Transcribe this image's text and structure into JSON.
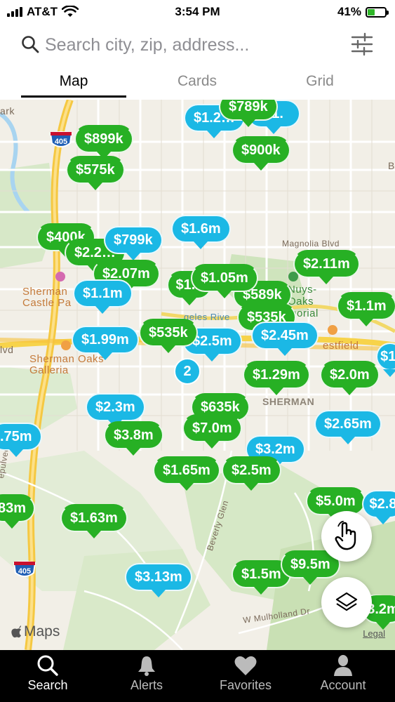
{
  "status_bar": {
    "carrier": "AT&T",
    "time": "3:54 PM",
    "battery": "41%",
    "battery_level": 0.41
  },
  "search": {
    "placeholder": "Search city, zip, address..."
  },
  "tabs": [
    {
      "label": "Map",
      "active": true
    },
    {
      "label": "Cards",
      "active": false
    },
    {
      "label": "Grid",
      "active": false
    }
  ],
  "map": {
    "labels": {
      "sherman_castle": "Sherman\nCastle Pa",
      "sherman_oaks_galleria": "Sherman Oaks\nGalleria",
      "magnolia": "Magnolia Blvd",
      "los_angeles_river": "geles Rive",
      "sherman": "SHERMAN",
      "westfield": "estfield",
      "nuys_oaks": "Nuys-\nOaks\nmorial",
      "sepulveda": "epulvec",
      "beverly_glen": "Beverly Glen",
      "mulholland": "W Mulholland Dr",
      "park_edge": "ark",
      "blvd": "lvd",
      "edge_b": "B"
    },
    "freeway_shields": [
      "405",
      "405"
    ],
    "pins": [
      {
        "price": "$1.2…",
        "color": "blue"
      },
      {
        "price": "$789k",
        "color": "green"
      },
      {
        "price": "$899k",
        "color": "green"
      },
      {
        "price": "$900k",
        "color": "green"
      },
      {
        "price": "$575k",
        "color": "green"
      },
      {
        "price": "$1.6m",
        "color": "blue"
      },
      {
        "price": "$400k",
        "color": "green"
      },
      {
        "price": "$799k",
        "color": "blue"
      },
      {
        "price": "$2.2…",
        "color": "green"
      },
      {
        "price": "$2.07m",
        "color": "green"
      },
      {
        "price": "$2.11m",
        "color": "green"
      },
      {
        "price": "$1.05m",
        "color": "green"
      },
      {
        "price": "$1.1m",
        "color": "blue"
      },
      {
        "price": "$1.1m",
        "color": "green"
      },
      {
        "price": "$589k",
        "color": "green"
      },
      {
        "price": "$535k",
        "color": "green"
      },
      {
        "price": "$1.99m",
        "color": "blue"
      },
      {
        "price": "$535k",
        "color": "green"
      },
      {
        "price": "$2.5m",
        "color": "blue"
      },
      {
        "price": "$2.45m",
        "color": "blue"
      },
      {
        "price": "$1.29m",
        "color": "green"
      },
      {
        "price": "$2.0m",
        "color": "green"
      },
      {
        "price": "$2.3m",
        "color": "blue"
      },
      {
        "price": "$635k",
        "color": "green"
      },
      {
        "price": "$7.0m",
        "color": "green"
      },
      {
        "price": "$3.8m",
        "color": "green"
      },
      {
        "price": "$2.65m",
        "color": "blue"
      },
      {
        "price": "$3.2m",
        "color": "blue"
      },
      {
        "price": ".75m",
        "color": "blue"
      },
      {
        "price": "$1.65m",
        "color": "green"
      },
      {
        "price": "$2.5m",
        "color": "green"
      },
      {
        "price": "$5.0m",
        "color": "green"
      },
      {
        "price": "83m",
        "color": "green"
      },
      {
        "price": "$1.63m",
        "color": "green"
      },
      {
        "price": "$2.8",
        "color": "blue"
      },
      {
        "price": "$3.13m",
        "color": "blue"
      },
      {
        "price": "$1.5m",
        "color": "green"
      },
      {
        "price": "$9.5m",
        "color": "green"
      },
      {
        "price": "3.2m",
        "color": "green"
      },
      {
        "price": "$1.",
        "color": "blue"
      },
      {
        "price": "$1.2",
        "color": "green"
      }
    ],
    "cluster": "2",
    "attribution": "Maps",
    "legal": "Legal"
  },
  "bottom_nav": [
    {
      "label": "Search",
      "icon": "search-icon",
      "active": true
    },
    {
      "label": "Alerts",
      "icon": "bell-icon",
      "active": false
    },
    {
      "label": "Favorites",
      "icon": "heart-icon",
      "active": false
    },
    {
      "label": "Account",
      "icon": "person-icon",
      "active": false
    }
  ],
  "colors": {
    "pin_green": "#27b024",
    "pin_blue": "#1bb8e5",
    "nav_bg": "#000000"
  }
}
